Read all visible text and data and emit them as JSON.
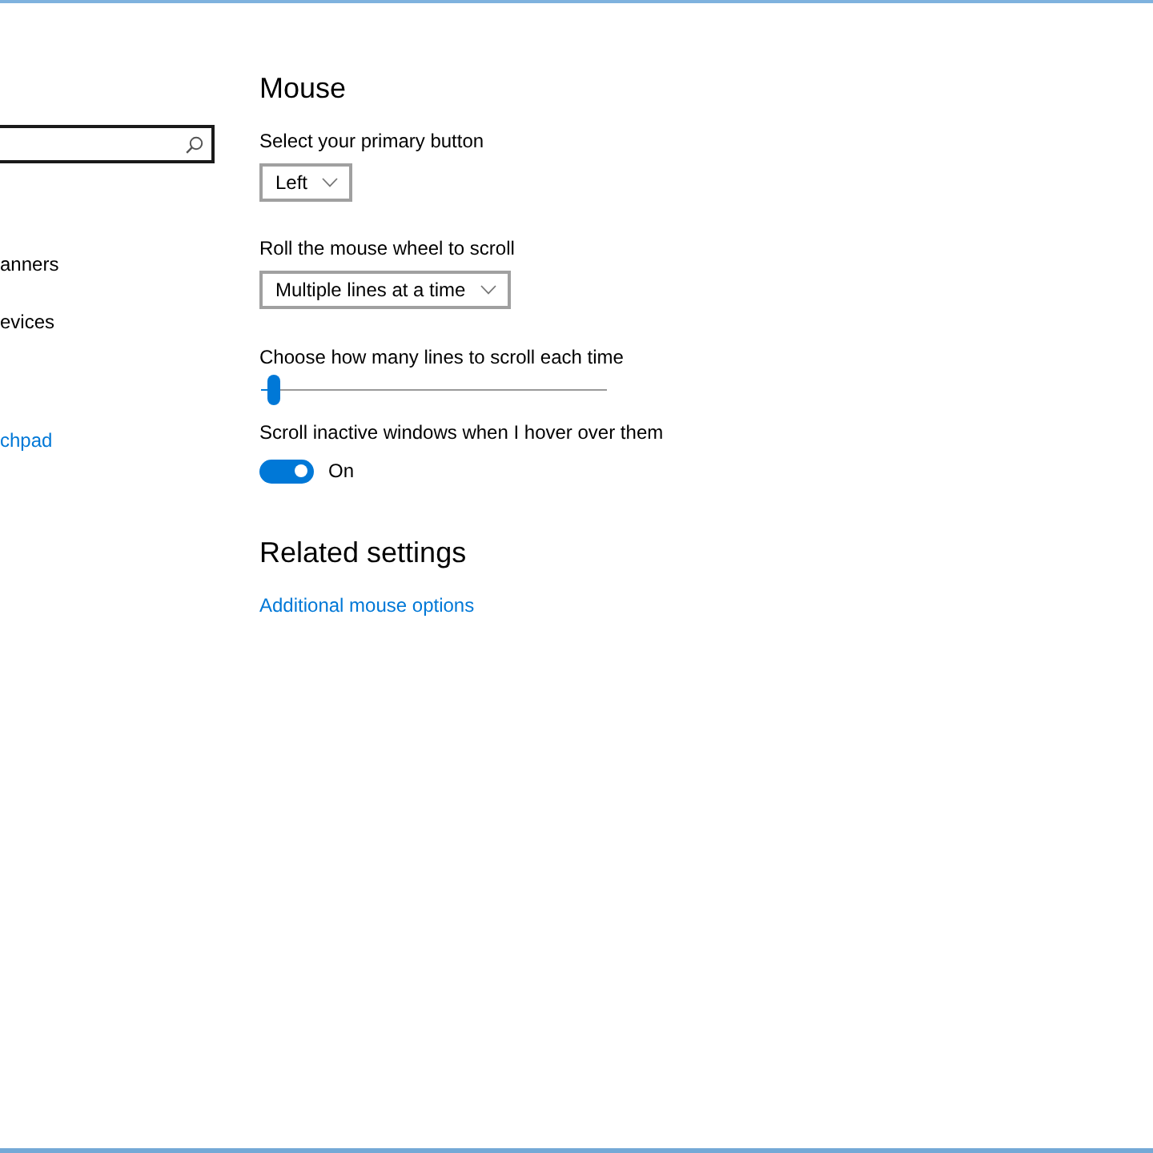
{
  "sidebar": {
    "items": [
      {
        "label": "anners",
        "selected": false
      },
      {
        "label": "evices",
        "selected": false
      },
      {
        "label": "chpad",
        "selected": true
      }
    ]
  },
  "page": {
    "title": "Mouse",
    "settings": [
      {
        "kind": "dropdown",
        "label": "Select your primary button",
        "value": "Left"
      },
      {
        "kind": "dropdown",
        "label": "Roll the mouse wheel to scroll",
        "value": "Multiple lines at a time"
      },
      {
        "kind": "slider",
        "label": "Choose how many lines to scroll each time",
        "level": 0.02
      },
      {
        "kind": "toggle",
        "label": "Scroll inactive windows when I hover over them",
        "on": true,
        "state_text": "On"
      }
    ]
  },
  "related_settings": {
    "title": "Related settings",
    "links": [
      "Additional mouse options"
    ]
  }
}
